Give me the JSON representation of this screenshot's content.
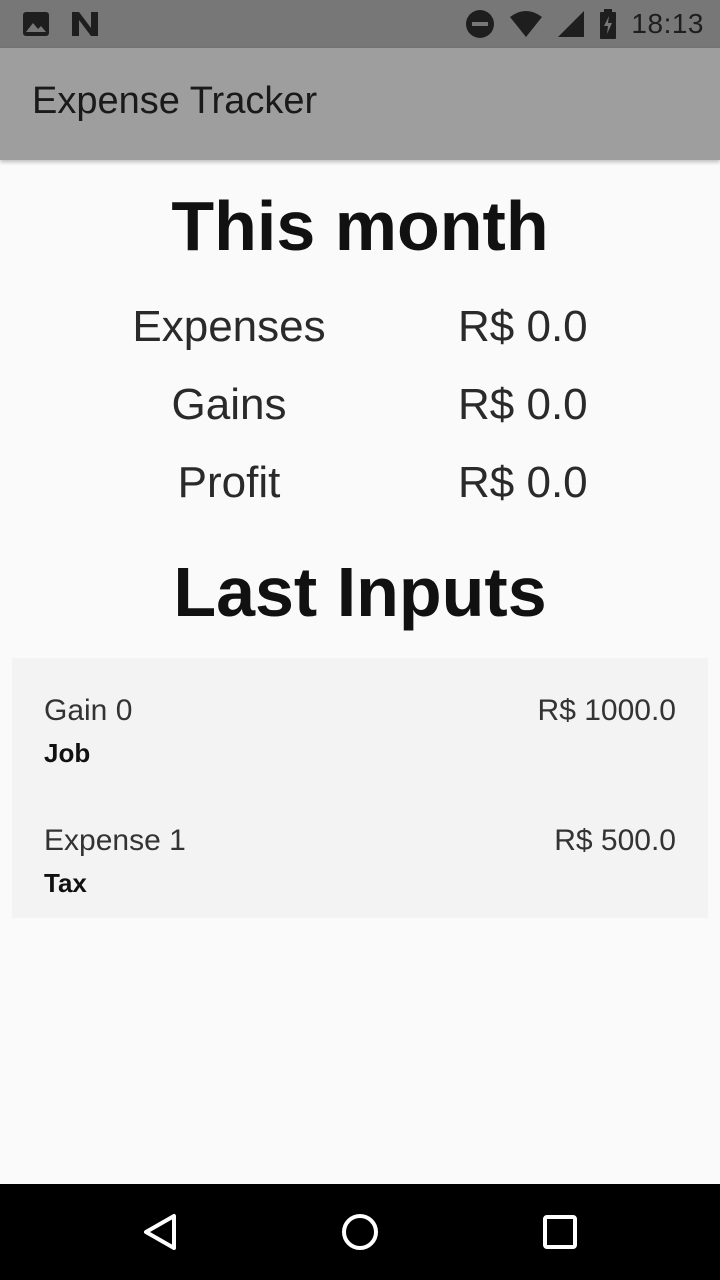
{
  "status_bar": {
    "time": "18:13",
    "icons": [
      "image-icon",
      "n-notification-icon",
      "do-not-disturb-icon",
      "wifi-icon",
      "cell-signal-icon",
      "battery-icon"
    ]
  },
  "app_bar": {
    "title": "Expense Tracker",
    "color": "#9e9e9e"
  },
  "this_month": {
    "heading": "This month",
    "rows": [
      {
        "label": "Expenses",
        "value": "R$ 0.0"
      },
      {
        "label": "Gains",
        "value": "R$ 0.0"
      },
      {
        "label": "Profit",
        "value": "R$ 0.0"
      }
    ]
  },
  "last_inputs": {
    "heading": "Last Inputs",
    "items": [
      {
        "name": "Gain 0",
        "category": "Job",
        "amount": "R$ 1000.0"
      },
      {
        "name": "Expense 1",
        "category": "Tax",
        "amount": "R$ 500.0"
      }
    ]
  },
  "nav_bar": {
    "icons": [
      "back-icon",
      "home-icon",
      "recents-icon"
    ]
  }
}
